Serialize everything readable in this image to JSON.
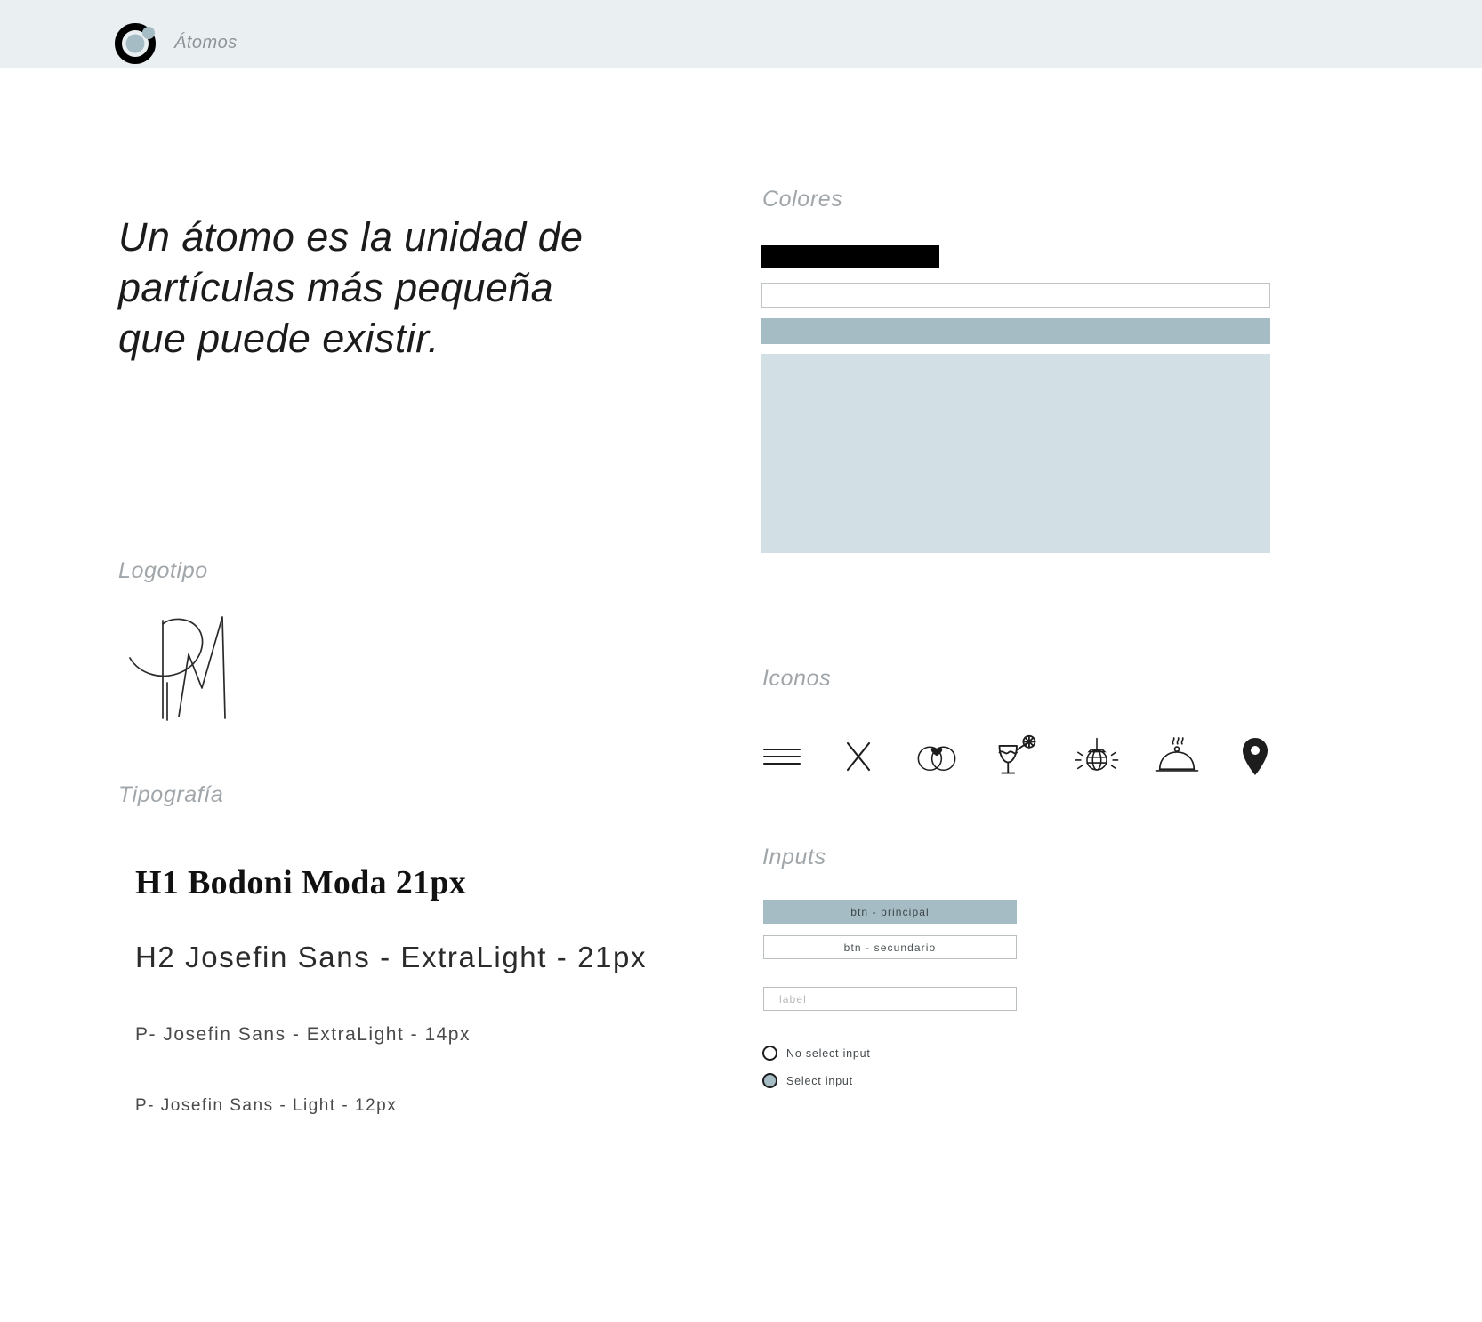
{
  "header": {
    "brand_name": "Átomos",
    "logo_icon": "atom-ring-icon"
  },
  "hero": {
    "quote": "Un átomo es la unidad de partículas más pequeña que puede existir."
  },
  "logotipo": {
    "title": "Logotipo",
    "monogram_icon": "pm-monogram-icon"
  },
  "tipografia": {
    "title": "Tipografía",
    "specimens": [
      {
        "text": "H1 Bodoni Moda 21px"
      },
      {
        "text": "H2 Josefin Sans - ExtraLight -  21px"
      },
      {
        "text": "P- Josefin Sans - ExtraLight -  14px"
      },
      {
        "text": "P- Josefin Sans - Light -  12px"
      }
    ]
  },
  "colores": {
    "title": "Colores",
    "swatches": [
      {
        "name": "black",
        "hex": "#000000"
      },
      {
        "name": "white",
        "hex": "#FFFFFF"
      },
      {
        "name": "blue-gray",
        "hex": "#A5BCC5"
      },
      {
        "name": "pale-blue",
        "hex": "#D2DFE4"
      }
    ]
  },
  "iconos": {
    "title": "Iconos",
    "items": [
      {
        "name": "hamburger-menu-icon"
      },
      {
        "name": "close-x-icon"
      },
      {
        "name": "wedding-rings-heart-icon"
      },
      {
        "name": "cocktail-glass-icon"
      },
      {
        "name": "disco-ball-icon"
      },
      {
        "name": "food-cloche-icon"
      },
      {
        "name": "location-pin-icon"
      }
    ]
  },
  "inputs": {
    "title": "Inputs",
    "btn_principal": "btn - principal",
    "btn_secundario": "btn - secundario",
    "field_placeholder": "label",
    "radios": [
      {
        "label": "No select input",
        "selected": false
      },
      {
        "label": "Select input",
        "selected": true
      }
    ]
  },
  "theme": {
    "header_bg": "#EAEFF2",
    "accent": "#A5BCC5",
    "accent_light": "#D2DFE4",
    "muted_text": "#A0A6AA"
  }
}
